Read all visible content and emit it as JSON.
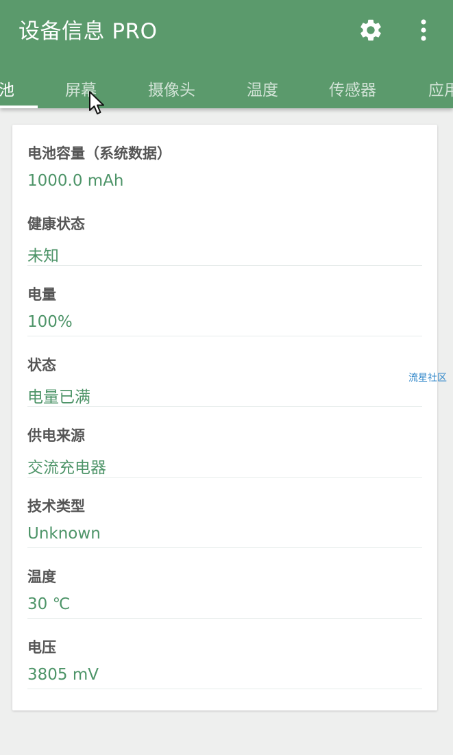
{
  "appbar": {
    "title": "设备信息 PRO",
    "settings_icon": "gear-icon",
    "more_icon": "more-vertical-icon",
    "bg_color": "#5b9a6c"
  },
  "tabs": [
    {
      "label": "池",
      "active": true
    },
    {
      "label": "屏幕",
      "active": false
    },
    {
      "label": "摄像头",
      "active": false
    },
    {
      "label": "温度",
      "active": false
    },
    {
      "label": "传感器",
      "active": false
    },
    {
      "label": "应用",
      "active": false
    }
  ],
  "battery": {
    "rows": [
      {
        "label": "电池容量（系统数据）",
        "value": "1000.0 mAh"
      },
      {
        "label": "健康状态",
        "value": "未知"
      },
      {
        "label": "电量",
        "value": "100%"
      },
      {
        "label": "状态",
        "value": "电量已满"
      },
      {
        "label": "供电来源",
        "value": "交流充电器"
      },
      {
        "label": "技术类型",
        "value": "Unknown"
      },
      {
        "label": "温度",
        "value": "30 ℃"
      },
      {
        "label": "电压",
        "value": "3805 mV"
      }
    ]
  },
  "watermark": "流星社区",
  "colors": {
    "accent": "#5b9a6c",
    "value_text": "#4d9468",
    "label_text": "#555555",
    "background": "#eeefee"
  }
}
